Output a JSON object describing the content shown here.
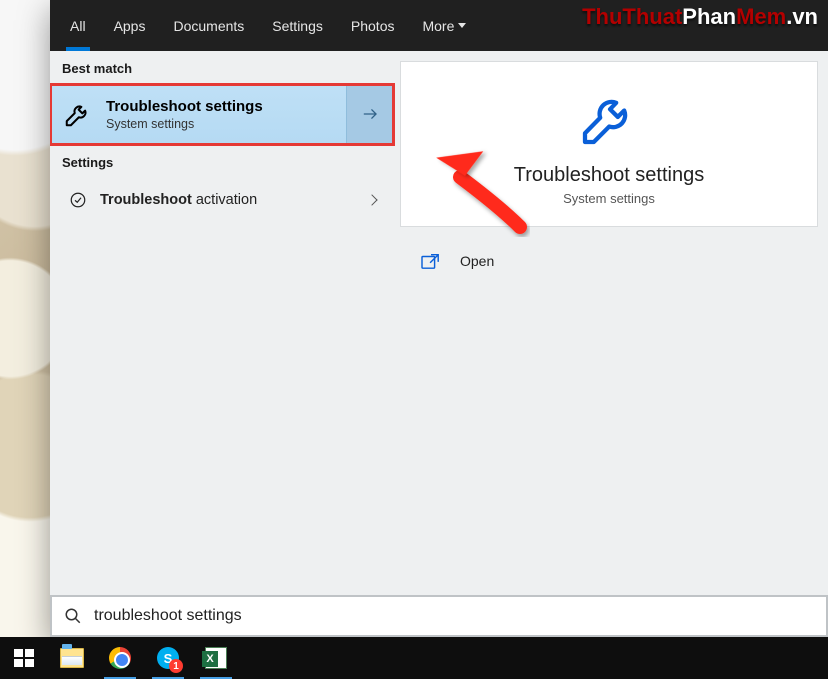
{
  "watermark": {
    "p1": "ThuThuat",
    "p2": "Phan",
    "p3": "Mem",
    "p4": ".vn"
  },
  "tabs": {
    "all": "All",
    "apps": "Apps",
    "documents": "Documents",
    "settings": "Settings",
    "photos": "Photos",
    "more": "More"
  },
  "sections": {
    "best_match": "Best match",
    "settings": "Settings"
  },
  "best_match": {
    "title": "Troubleshoot settings",
    "subtitle": "System settings"
  },
  "settings_result": {
    "bold": "Troubleshoot",
    "rest": " activation"
  },
  "detail": {
    "title": "Troubleshoot settings",
    "subtitle": "System settings"
  },
  "actions": {
    "open": "Open"
  },
  "search": {
    "value": "troubleshoot settings"
  },
  "skype_badge": "1"
}
